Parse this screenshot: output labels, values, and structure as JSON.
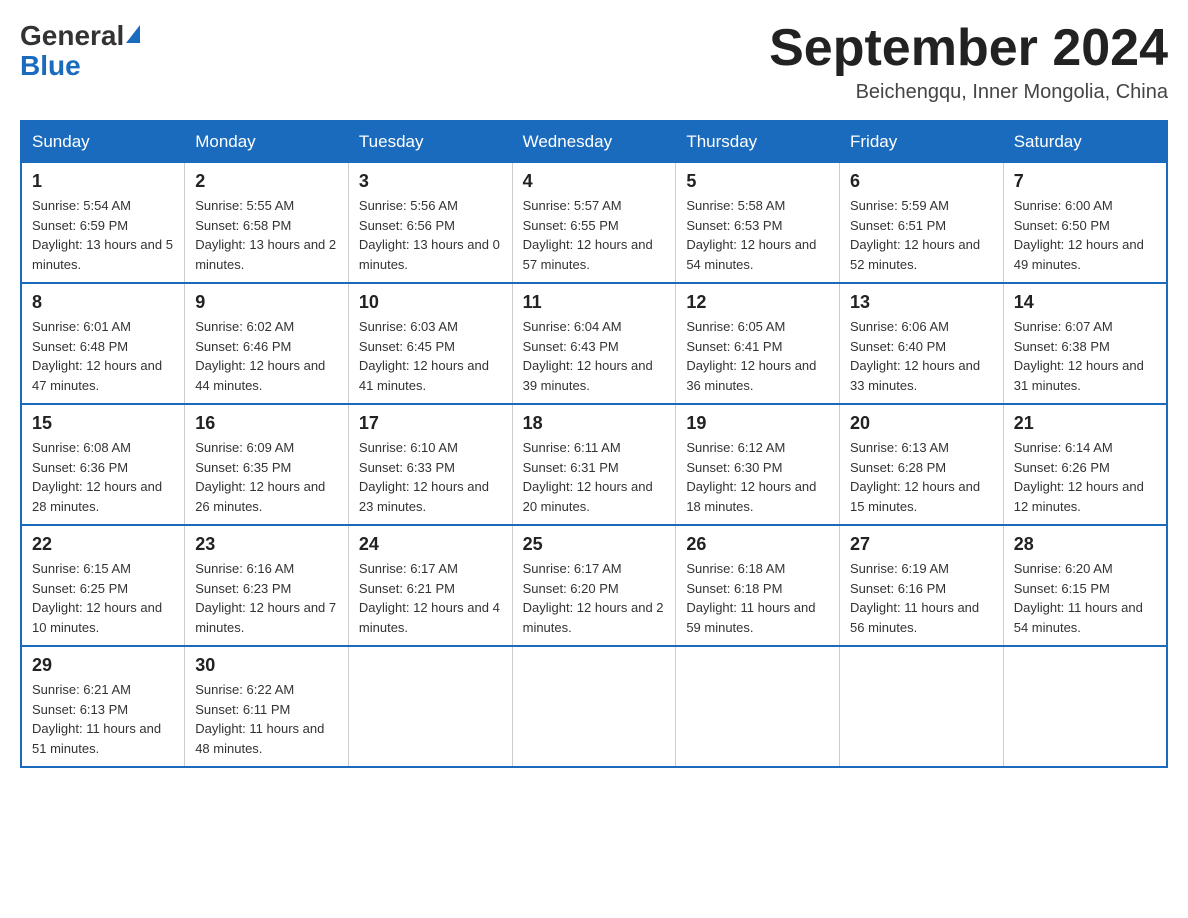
{
  "header": {
    "logo_general": "General",
    "logo_blue": "Blue",
    "month_title": "September 2024",
    "location": "Beichengqu, Inner Mongolia, China"
  },
  "weekdays": [
    "Sunday",
    "Monday",
    "Tuesday",
    "Wednesday",
    "Thursday",
    "Friday",
    "Saturday"
  ],
  "weeks": [
    [
      {
        "day": "1",
        "sunrise": "5:54 AM",
        "sunset": "6:59 PM",
        "daylight": "13 hours and 5 minutes."
      },
      {
        "day": "2",
        "sunrise": "5:55 AM",
        "sunset": "6:58 PM",
        "daylight": "13 hours and 2 minutes."
      },
      {
        "day": "3",
        "sunrise": "5:56 AM",
        "sunset": "6:56 PM",
        "daylight": "13 hours and 0 minutes."
      },
      {
        "day": "4",
        "sunrise": "5:57 AM",
        "sunset": "6:55 PM",
        "daylight": "12 hours and 57 minutes."
      },
      {
        "day": "5",
        "sunrise": "5:58 AM",
        "sunset": "6:53 PM",
        "daylight": "12 hours and 54 minutes."
      },
      {
        "day": "6",
        "sunrise": "5:59 AM",
        "sunset": "6:51 PM",
        "daylight": "12 hours and 52 minutes."
      },
      {
        "day": "7",
        "sunrise": "6:00 AM",
        "sunset": "6:50 PM",
        "daylight": "12 hours and 49 minutes."
      }
    ],
    [
      {
        "day": "8",
        "sunrise": "6:01 AM",
        "sunset": "6:48 PM",
        "daylight": "12 hours and 47 minutes."
      },
      {
        "day": "9",
        "sunrise": "6:02 AM",
        "sunset": "6:46 PM",
        "daylight": "12 hours and 44 minutes."
      },
      {
        "day": "10",
        "sunrise": "6:03 AM",
        "sunset": "6:45 PM",
        "daylight": "12 hours and 41 minutes."
      },
      {
        "day": "11",
        "sunrise": "6:04 AM",
        "sunset": "6:43 PM",
        "daylight": "12 hours and 39 minutes."
      },
      {
        "day": "12",
        "sunrise": "6:05 AM",
        "sunset": "6:41 PM",
        "daylight": "12 hours and 36 minutes."
      },
      {
        "day": "13",
        "sunrise": "6:06 AM",
        "sunset": "6:40 PM",
        "daylight": "12 hours and 33 minutes."
      },
      {
        "day": "14",
        "sunrise": "6:07 AM",
        "sunset": "6:38 PM",
        "daylight": "12 hours and 31 minutes."
      }
    ],
    [
      {
        "day": "15",
        "sunrise": "6:08 AM",
        "sunset": "6:36 PM",
        "daylight": "12 hours and 28 minutes."
      },
      {
        "day": "16",
        "sunrise": "6:09 AM",
        "sunset": "6:35 PM",
        "daylight": "12 hours and 26 minutes."
      },
      {
        "day": "17",
        "sunrise": "6:10 AM",
        "sunset": "6:33 PM",
        "daylight": "12 hours and 23 minutes."
      },
      {
        "day": "18",
        "sunrise": "6:11 AM",
        "sunset": "6:31 PM",
        "daylight": "12 hours and 20 minutes."
      },
      {
        "day": "19",
        "sunrise": "6:12 AM",
        "sunset": "6:30 PM",
        "daylight": "12 hours and 18 minutes."
      },
      {
        "day": "20",
        "sunrise": "6:13 AM",
        "sunset": "6:28 PM",
        "daylight": "12 hours and 15 minutes."
      },
      {
        "day": "21",
        "sunrise": "6:14 AM",
        "sunset": "6:26 PM",
        "daylight": "12 hours and 12 minutes."
      }
    ],
    [
      {
        "day": "22",
        "sunrise": "6:15 AM",
        "sunset": "6:25 PM",
        "daylight": "12 hours and 10 minutes."
      },
      {
        "day": "23",
        "sunrise": "6:16 AM",
        "sunset": "6:23 PM",
        "daylight": "12 hours and 7 minutes."
      },
      {
        "day": "24",
        "sunrise": "6:17 AM",
        "sunset": "6:21 PM",
        "daylight": "12 hours and 4 minutes."
      },
      {
        "day": "25",
        "sunrise": "6:17 AM",
        "sunset": "6:20 PM",
        "daylight": "12 hours and 2 minutes."
      },
      {
        "day": "26",
        "sunrise": "6:18 AM",
        "sunset": "6:18 PM",
        "daylight": "11 hours and 59 minutes."
      },
      {
        "day": "27",
        "sunrise": "6:19 AM",
        "sunset": "6:16 PM",
        "daylight": "11 hours and 56 minutes."
      },
      {
        "day": "28",
        "sunrise": "6:20 AM",
        "sunset": "6:15 PM",
        "daylight": "11 hours and 54 minutes."
      }
    ],
    [
      {
        "day": "29",
        "sunrise": "6:21 AM",
        "sunset": "6:13 PM",
        "daylight": "11 hours and 51 minutes."
      },
      {
        "day": "30",
        "sunrise": "6:22 AM",
        "sunset": "6:11 PM",
        "daylight": "11 hours and 48 minutes."
      },
      null,
      null,
      null,
      null,
      null
    ]
  ]
}
